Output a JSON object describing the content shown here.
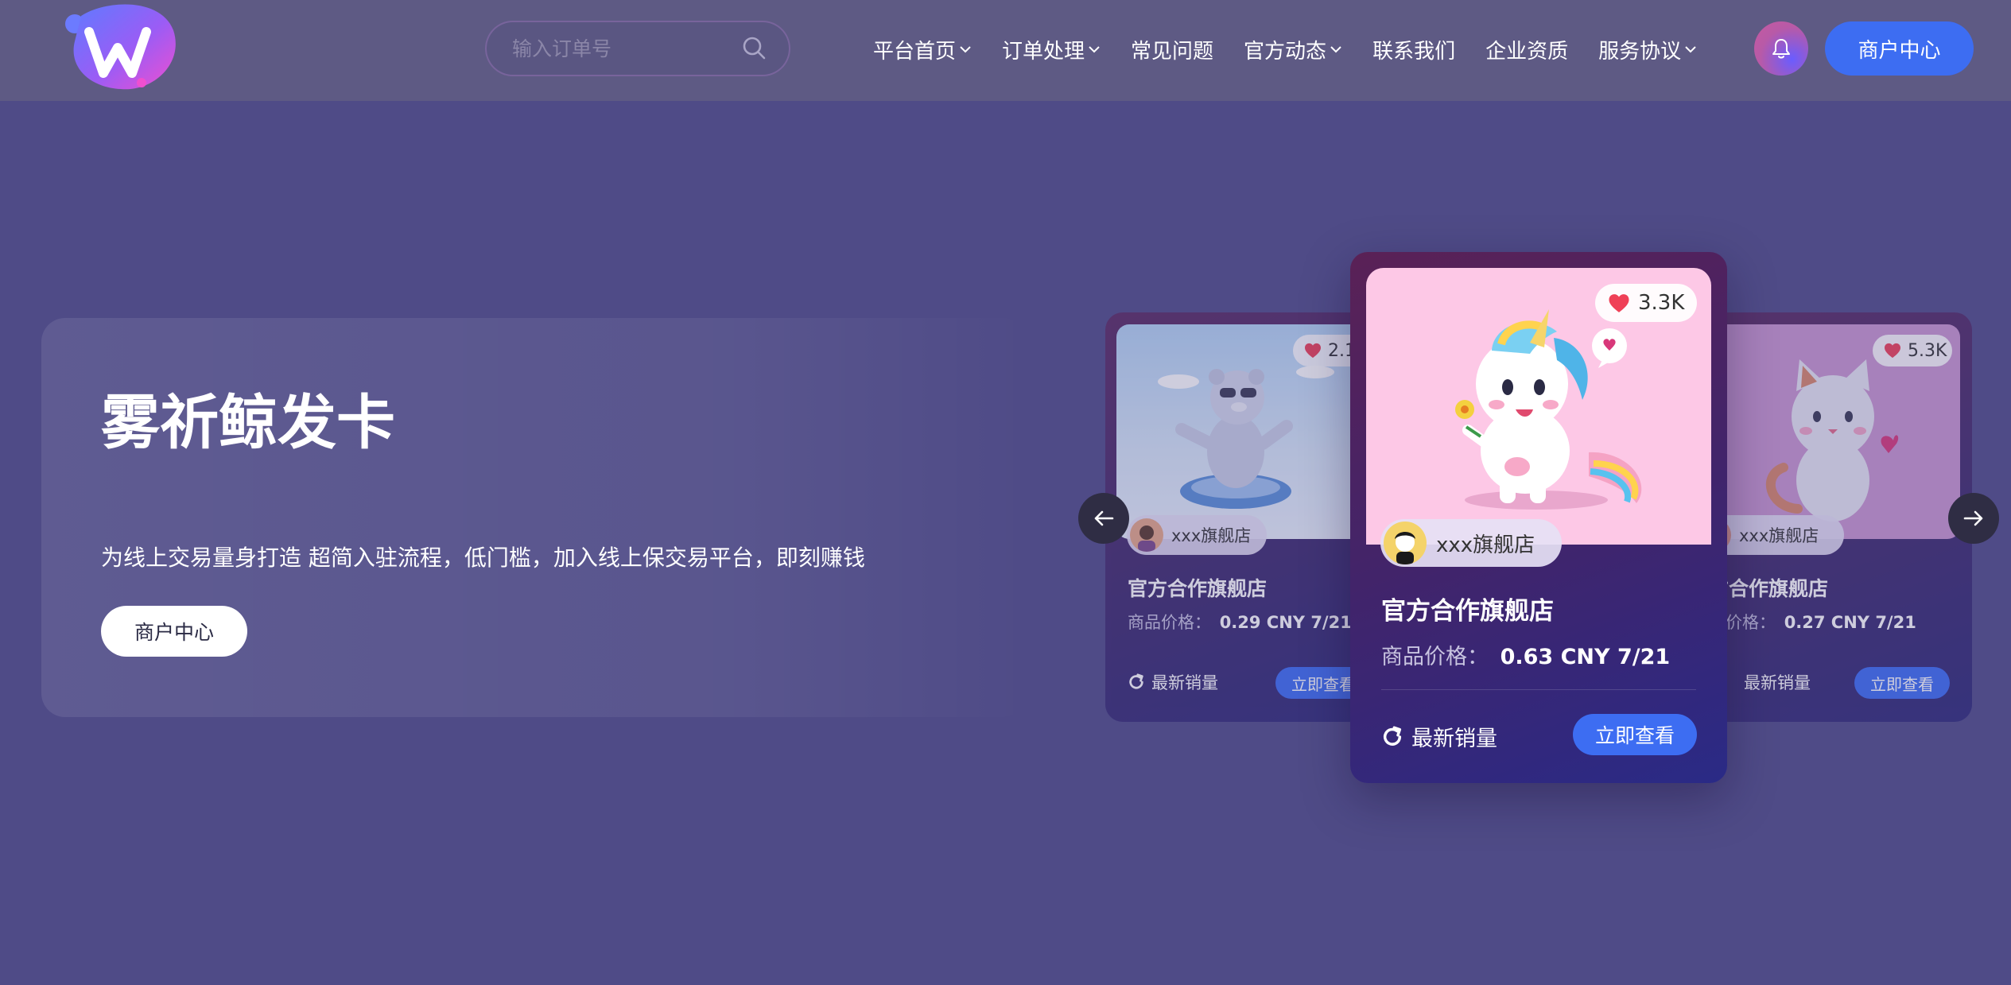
{
  "header": {
    "search_placeholder": "输入订单号",
    "nav": [
      {
        "label": "平台首页",
        "has_dropdown": true
      },
      {
        "label": "订单处理",
        "has_dropdown": true
      },
      {
        "label": "常见问题",
        "has_dropdown": false
      },
      {
        "label": "官方动态",
        "has_dropdown": true
      },
      {
        "label": "联系我们",
        "has_dropdown": false
      },
      {
        "label": "企业资质",
        "has_dropdown": false
      },
      {
        "label": "服务协议",
        "has_dropdown": true
      }
    ],
    "merchant_button": "商户中心"
  },
  "hero": {
    "title": "雾祈鲸发卡",
    "subtitle": "为线上交易量身打造 超简入驻流程，低门槛，加入线上保交易平台，即刻赚钱",
    "button": "商户中心"
  },
  "cards": {
    "left": {
      "likes": "2.1",
      "shop": "xxx旗舰店",
      "title": "官方合作旗舰店",
      "price_label": "商品价格：",
      "price_value": "0.29 CNY 7/21",
      "sales": "最新销量",
      "view": "立即查看"
    },
    "center": {
      "likes": "3.3K",
      "shop": "xxx旗舰店",
      "title": "官方合作旗舰店",
      "price_label": "商品价格：",
      "price_value": "0.63 CNY 7/21",
      "sales": "最新销量",
      "view": "立即查看"
    },
    "right": {
      "likes": "5.3K",
      "shop": "xxx旗舰店",
      "title": "方合作旗舰店",
      "price_label": "品价格：",
      "price_value": "0.27 CNY 7/21",
      "sales": "最新销量",
      "view": "立即查看"
    }
  },
  "colors": {
    "background": "#4f4b87",
    "header": "#5e5a84",
    "accent": "#3d6df2"
  }
}
